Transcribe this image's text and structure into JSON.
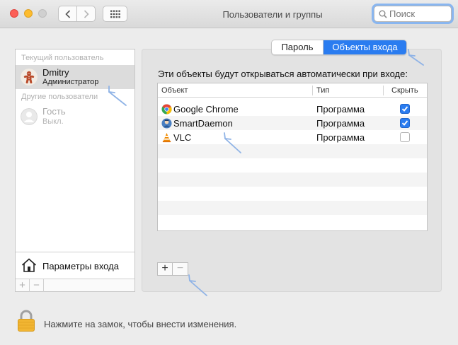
{
  "window": {
    "title": "Пользователи и группы"
  },
  "search": {
    "placeholder": "Поиск"
  },
  "sidebar": {
    "current_header": "Текущий пользователь",
    "current_user": {
      "name": "Dmitry",
      "role": "Администратор"
    },
    "other_header": "Другие пользователи",
    "guest": {
      "name": "Гость",
      "status": "Выкл."
    },
    "login_options_label": "Параметры входа",
    "add_label": "+",
    "remove_label": "−"
  },
  "tabs": [
    {
      "label": "Пароль",
      "selected": false
    },
    {
      "label": "Объекты входа",
      "selected": true
    }
  ],
  "main": {
    "description": "Эти объекты будут открываться автоматически при входе:",
    "columns": [
      "Объект",
      "Тип",
      "Скрыть"
    ],
    "rows": [
      {
        "name": "Google Chrome",
        "type": "Программа",
        "hide": true,
        "icon": "chrome-icon"
      },
      {
        "name": "SmartDaemon",
        "type": "Программа",
        "hide": true,
        "icon": "smartdaemon-icon"
      },
      {
        "name": "VLC",
        "type": "Программа",
        "hide": false,
        "icon": "vlc-icon"
      }
    ],
    "add_label": "+",
    "remove_label": "−"
  },
  "lock_text": "Нажмите на замок, чтобы внести изменения.",
  "colors": {
    "accent": "#2a7cf0",
    "annotation": "#8fb3e6"
  }
}
